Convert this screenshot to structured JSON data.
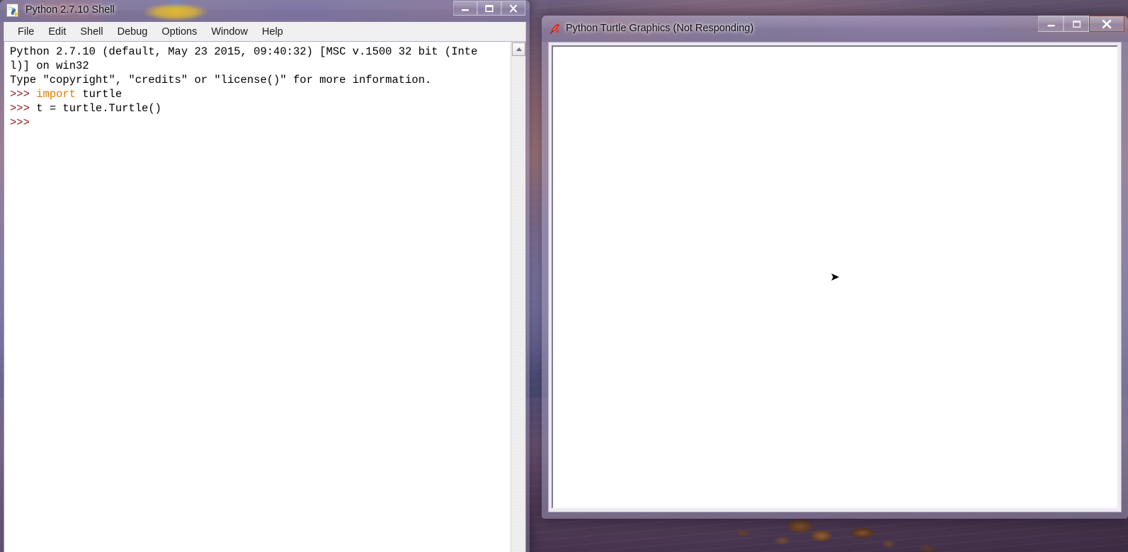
{
  "desktop": {
    "wallpaper_description": "purple sunset over water with rocks",
    "colors": {
      "sky_top": "#6d5f7e",
      "sky_warm": "#b98a8c",
      "water": "#6d5374",
      "rock": "#8a5a35"
    }
  },
  "idle_window": {
    "title": "Python 2.7.10 Shell",
    "icon": "python-idle-icon",
    "window_buttons": {
      "minimize": "—",
      "maximize": "❐",
      "close": "✕",
      "minimize_name": "minimize",
      "maximize_name": "maximize",
      "close_name": "close"
    },
    "menu": [
      {
        "label": "File"
      },
      {
        "label": "Edit"
      },
      {
        "label": "Shell"
      },
      {
        "label": "Debug"
      },
      {
        "label": "Options"
      },
      {
        "label": "Window"
      },
      {
        "label": "Help"
      }
    ],
    "shell": {
      "lines": [
        [
          {
            "text": "Python 2.7.10 (default, May 23 2015, 09:40:32) [MSC v.1500 32 bit (Inte",
            "type": "plain"
          }
        ],
        [
          {
            "text": "l)] on win32",
            "type": "plain"
          }
        ],
        [
          {
            "text": "Type \"copyright\", \"credits\" or \"license()\" for more information.",
            "type": "plain"
          }
        ],
        [
          {
            "text": ">>> ",
            "type": "prompt"
          },
          {
            "text": "import",
            "type": "keyword"
          },
          {
            "text": " turtle",
            "type": "plain"
          }
        ],
        [
          {
            "text": ">>> ",
            "type": "prompt"
          },
          {
            "text": "t = turtle.Turtle()",
            "type": "plain"
          }
        ],
        [
          {
            "text": ">>> ",
            "type": "prompt"
          }
        ]
      ],
      "colors": {
        "prompt": "#8b1a1a",
        "keyword": "#e07b00",
        "plain": "#000000",
        "background": "#ffffff"
      }
    },
    "scrollbar": {
      "up_arrow": "scroll-up-arrow"
    }
  },
  "turtle_window": {
    "title": "Python Turtle Graphics (Not Responding)",
    "icon": "tk-feather-icon",
    "status": "Not Responding",
    "window_buttons": {
      "minimize": "—",
      "maximize": "❐",
      "close": "✕",
      "close_state": "hover-highlighted",
      "close_color": "#e14f1c"
    },
    "canvas": {
      "background": "#ffffff",
      "turtle_cursor": "turtle-arrow",
      "turtle_color": "#000000",
      "turtle_position": "center"
    }
  }
}
